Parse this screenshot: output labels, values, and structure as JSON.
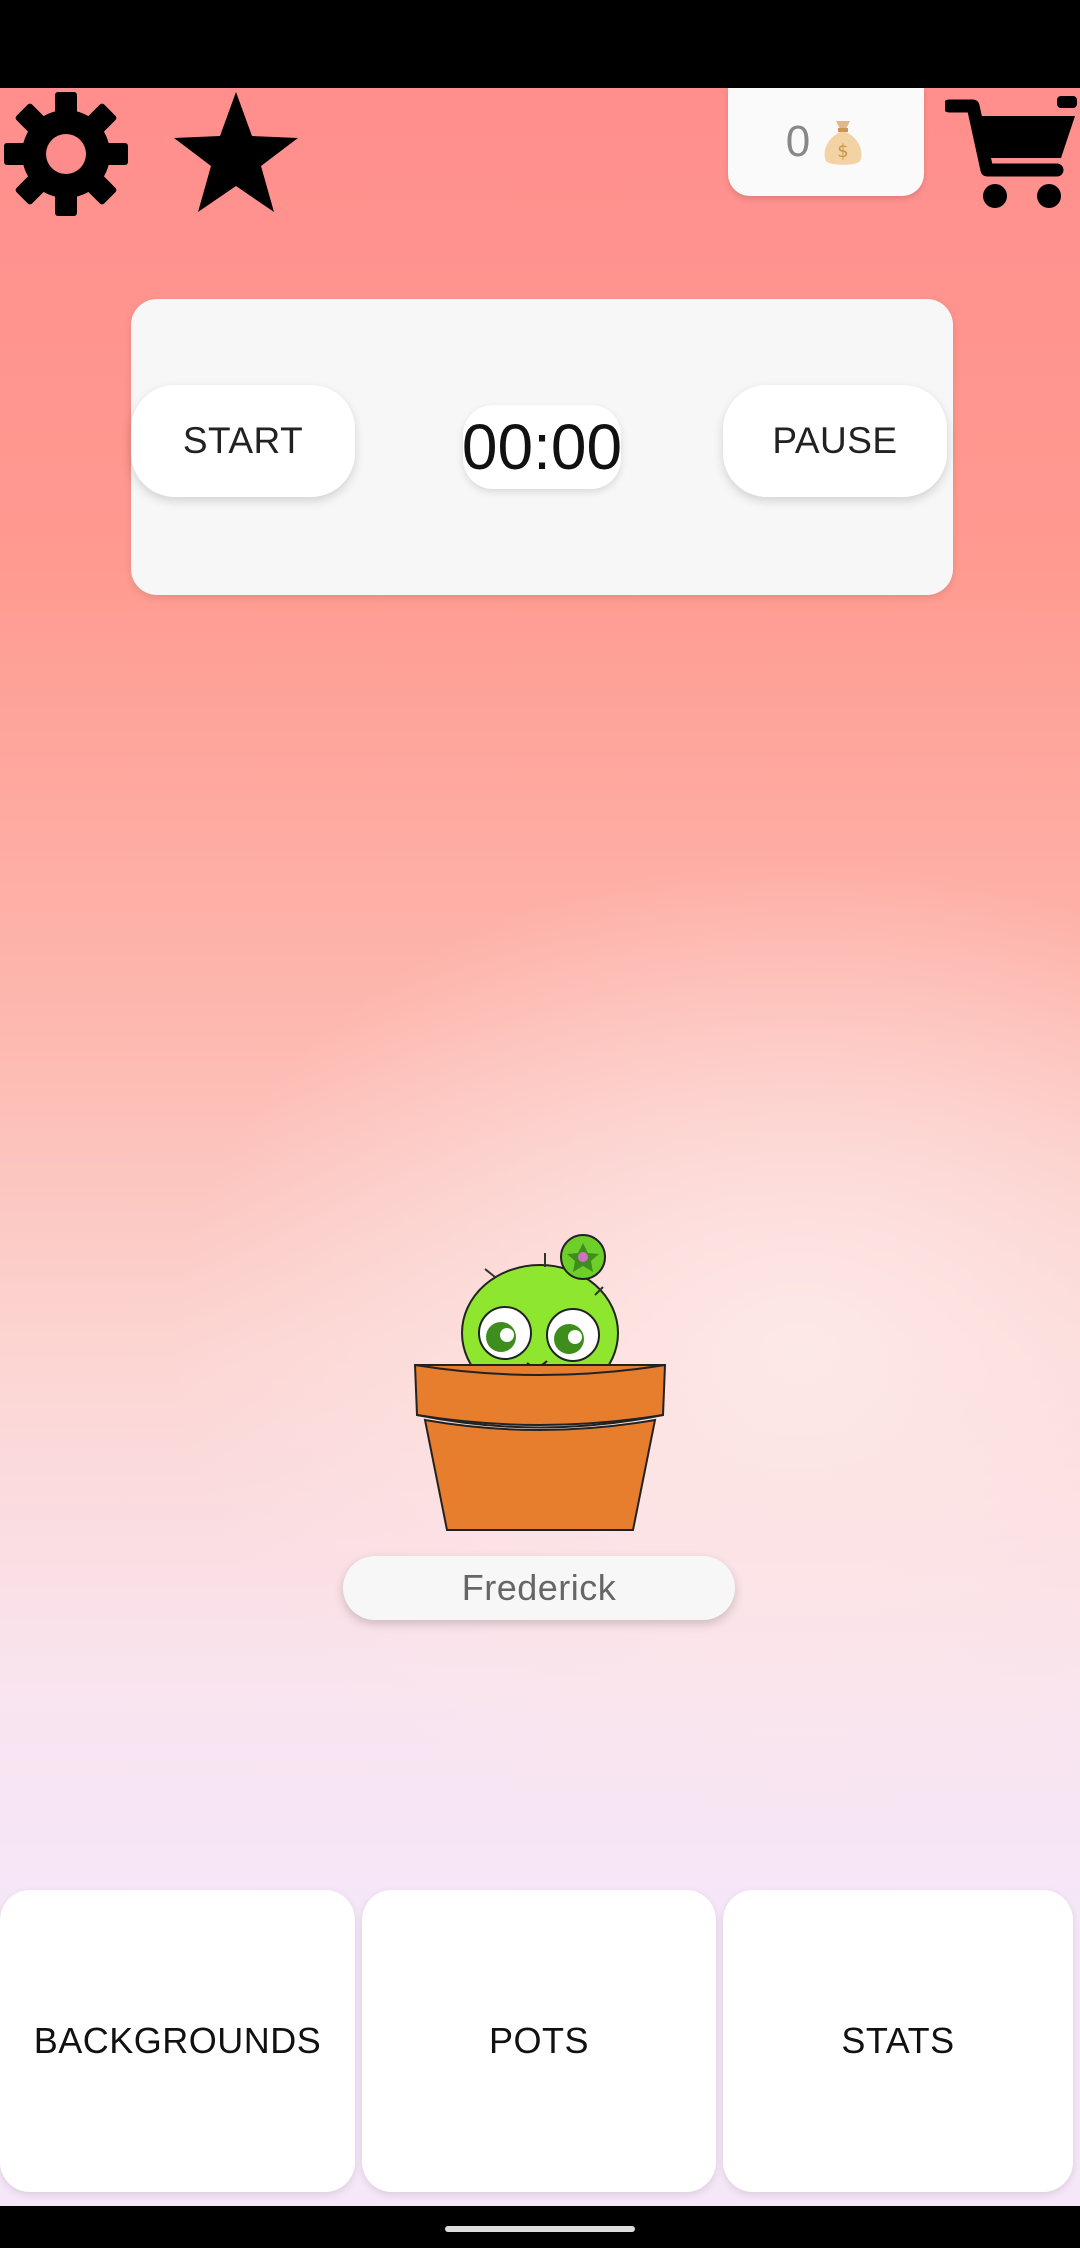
{
  "header": {
    "coins": {
      "amount": "0",
      "icon": "money-bag-icon"
    },
    "icons": [
      "gear-icon",
      "star-icon",
      "shopping-cart-icon"
    ]
  },
  "timer": {
    "start_label": "START",
    "time": "00:00",
    "pause_label": "PAUSE"
  },
  "plant": {
    "name": "Frederick"
  },
  "bottom_nav": {
    "backgrounds_label": "BACKGROUNDS",
    "pots_label": "POTS",
    "stats_label": "STATS"
  },
  "colors": {
    "background_top": "#ff8c8c",
    "background_bottom": "#f5e6f8",
    "pot": "#e67e2e",
    "cactus": "#8ee62e"
  }
}
